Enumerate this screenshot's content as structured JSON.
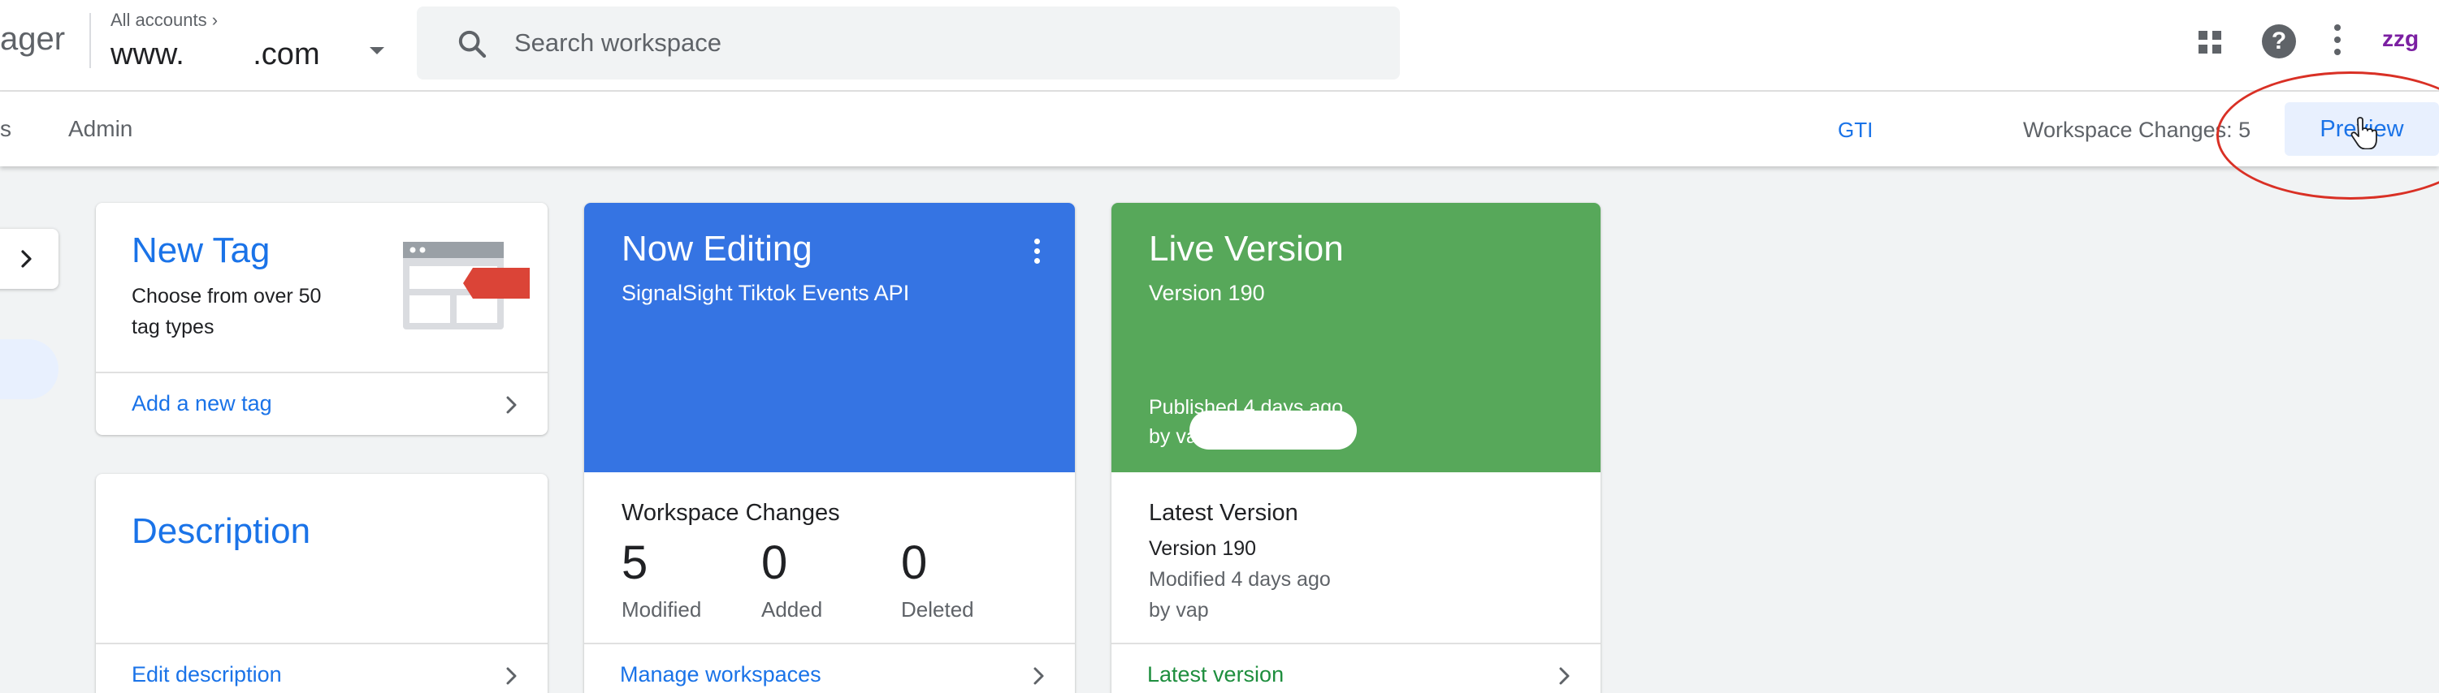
{
  "header": {
    "app_name_fragment": "ager",
    "account_crumb": "All accounts  ›",
    "account_name": "www.        .com",
    "search_placeholder": "Search workspace",
    "icons": [
      "apps-icon",
      "help-icon",
      "more-vert-icon"
    ],
    "avatar_text": "zzg"
  },
  "nav": {
    "partial_tab": "s",
    "admin_tab": "Admin",
    "gtm_id": "GTI",
    "workspace_changes": "Workspace Changes: 5",
    "preview_label": "Preview"
  },
  "cards": {
    "new_tag": {
      "title": "New Tag",
      "subtitle": "Choose from over 50 tag types",
      "link": "Add a new tag"
    },
    "description": {
      "title": "Description",
      "link": "Edit description"
    },
    "now_editing": {
      "title": "Now Editing",
      "workspace": "SignalSight Tiktok Events API",
      "section_title": "Workspace Changes",
      "stats": [
        {
          "value": "5",
          "label": "Modified"
        },
        {
          "value": "0",
          "label": "Added"
        },
        {
          "value": "0",
          "label": "Deleted"
        }
      ],
      "link": "Manage workspaces"
    },
    "live_version": {
      "title": "Live Version",
      "version": "Version 190",
      "published": "Published 4 days ago",
      "published_by": "by va",
      "section_title": "Latest Version",
      "latest_version": "Version 190",
      "modified": "Modified 4 days ago",
      "modified_by": "by vap",
      "link": "Latest version"
    }
  },
  "colors": {
    "accent_blue": "#1a73e8",
    "now_editing_bg": "#3574e3",
    "live_version_bg": "#57a85a",
    "annotation_red": "#d93025",
    "page_bg": "#f1f3f4"
  }
}
